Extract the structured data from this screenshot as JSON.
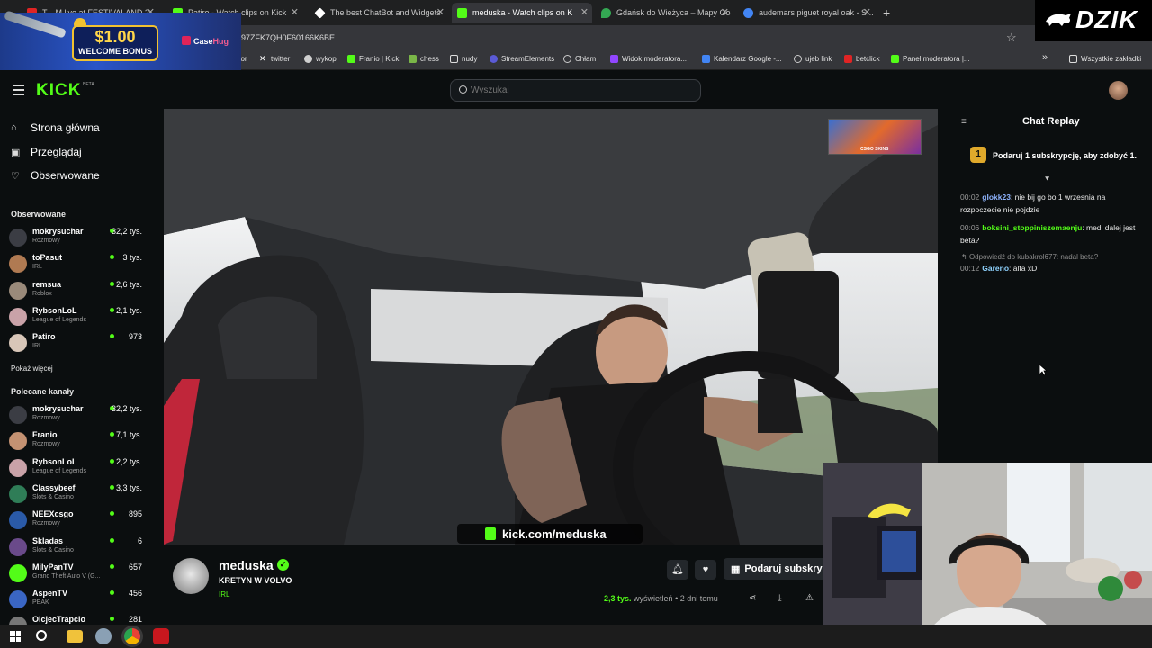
{
  "browser": {
    "tabs": [
      {
        "label": "T... M live at FESTIVALAND 2...",
        "color": "#e02424"
      },
      {
        "label": "Patiro - Watch clips on Kick",
        "color": "#53fc18"
      },
      {
        "label": "The best ChatBot and Widgets",
        "color": "#ffffff"
      },
      {
        "label": "meduska - Watch clips on K",
        "color": "#53fc18"
      },
      {
        "label": "Gdańsk do Wieżyca – Mapy Go",
        "color": "#34a853"
      },
      {
        "label": "audemars piguet royal oak - S...",
        "color": "#4285f4"
      }
    ],
    "new_tab": "+",
    "url": "97ZFK7QH0F60166K6BE",
    "bookmarks": [
      {
        "label": "...zior",
        "color": "#888888"
      },
      {
        "label": "twitter",
        "color": "#ffffff"
      },
      {
        "label": "wykop",
        "color": "#cfcfcf"
      },
      {
        "label": "Franio | Kick",
        "color": "#53fc18"
      },
      {
        "label": "chess",
        "color": "#7ab648"
      },
      {
        "label": "nudy",
        "color": "#dddddd"
      },
      {
        "label": "StreamElements",
        "color": "#5b5bd6"
      },
      {
        "label": "Chłam",
        "color": "#cccccc"
      },
      {
        "label": "Widok moderatora...",
        "color": "#9146ff"
      },
      {
        "label": "Kalendarz Google -...",
        "color": "#4285f4"
      },
      {
        "label": "ujeb link",
        "color": "#cccccc"
      },
      {
        "label": "betclick",
        "color": "#e02424"
      },
      {
        "label": "Panel moderatora |...",
        "color": "#53fc18"
      }
    ],
    "more": "»",
    "all_bookmarks": "Wszystkie zakładki"
  },
  "ad": {
    "amount": "$1.00",
    "welcome": "WELCOME BONUS",
    "brand_a": "Case",
    "brand_b": "Hug"
  },
  "watermark": "DZIK",
  "header": {
    "logo": "KICK",
    "beta": "BETA",
    "search_placeholder": "Wyszukaj"
  },
  "sidebar": {
    "nav": [
      {
        "label": "Strona główna",
        "icon": "home-icon"
      },
      {
        "label": "Przeglądaj",
        "icon": "browse-icon"
      },
      {
        "label": "Obserwowane",
        "icon": "heart-icon"
      }
    ],
    "followed_heading": "Obserwowane",
    "followed": [
      {
        "name": "mokrysuchar",
        "category": "Rozmowy",
        "viewers": "32,2 tys.",
        "color": "#3b3d44"
      },
      {
        "name": "toPasut",
        "category": "IRL",
        "viewers": "3 tys.",
        "color": "#b07a52"
      },
      {
        "name": "remsua",
        "category": "Roblox",
        "viewers": "2,6 tys.",
        "color": "#9a8a7a"
      },
      {
        "name": "RybsonLoL",
        "category": "League of Legends",
        "viewers": "2,1 tys.",
        "color": "#c9a2a8"
      },
      {
        "name": "Patiro",
        "category": "IRL",
        "viewers": "973",
        "color": "#d8c6b8"
      }
    ],
    "show_more": "Pokaż więcej",
    "recommended_heading": "Polecane kanały",
    "recommended": [
      {
        "name": "mokrysuchar",
        "category": "Rozmowy",
        "viewers": "32,2 tys.",
        "color": "#3b3d44"
      },
      {
        "name": "Franio",
        "category": "Rozmowy",
        "viewers": "7,1 tys.",
        "color": "#c49272"
      },
      {
        "name": "RybsonLoL",
        "category": "League of Legends",
        "viewers": "2,2 tys.",
        "color": "#c9a2a8"
      },
      {
        "name": "Classybeef",
        "category": "Slots & Casino",
        "viewers": "3,3 tys.",
        "color": "#2f7d57"
      },
      {
        "name": "NEEXcsgo",
        "category": "Rozmowy",
        "viewers": "895",
        "color": "#2a5aa8"
      },
      {
        "name": "Skladas",
        "category": "Slots & Casino",
        "viewers": "6",
        "color": "#6a4a8a"
      },
      {
        "name": "MilyPanTV",
        "category": "Grand Theft Auto V (G...",
        "viewers": "657",
        "color": "#53fc18"
      },
      {
        "name": "AspenTV",
        "category": "PEAK",
        "viewers": "456",
        "color": "#3a66c4"
      },
      {
        "name": "OicjecTrapcio",
        "category": "",
        "viewers": "281",
        "color": "#777777"
      }
    ]
  },
  "video": {
    "promo_label": "CSGO SKINS",
    "overlay_url": "kick.com/meduska"
  },
  "clip": {
    "channel": "meduska",
    "title": "KRETYN W VOLVO",
    "category": "IRL",
    "gift_label": "Podaruj subskrypcję",
    "views": "2,3 tys.",
    "views_label": "wyświetleń",
    "age": "• 2 dni temu"
  },
  "chat": {
    "title": "Chat Replay",
    "sub_badge": "1",
    "sub_prompt": "Podaruj 1 subskrypcję, aby zdobyć 1.",
    "messages": [
      {
        "time": "00:02",
        "user": "glokk23",
        "color": "#8fb4ff",
        "text": ": nie bij go bo 1 wrzesnia na rozpoczecie nie pojdzie"
      },
      {
        "time": "00:06",
        "user": "boksini_stoppiniszemaenju",
        "color": "#53fc18",
        "text": ": medi dalej jest beta?"
      }
    ],
    "reply_to": "Odpowiedź do kubakrol677: nadal beta?",
    "reply": {
      "time": "00:12",
      "user": "Gareno",
      "color": "#8fd3ff",
      "text": ": alfa xD"
    }
  }
}
